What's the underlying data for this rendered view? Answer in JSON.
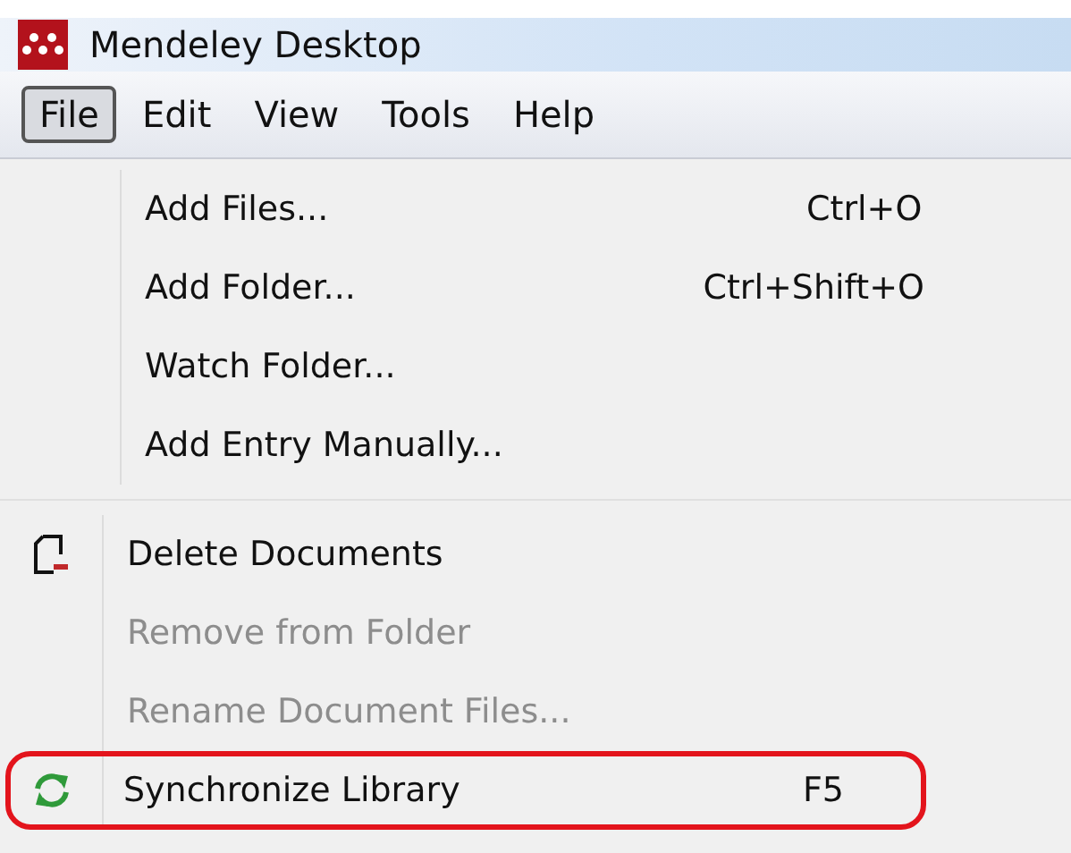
{
  "window": {
    "title": "Mendeley Desktop"
  },
  "menubar": [
    {
      "label": "File",
      "selected": true
    },
    {
      "label": "Edit",
      "selected": false
    },
    {
      "label": "View",
      "selected": false
    },
    {
      "label": "Tools",
      "selected": false
    },
    {
      "label": "Help",
      "selected": false
    }
  ],
  "menu_groups": [
    {
      "items": [
        {
          "label": "Add Files...",
          "shortcut": "Ctrl+O",
          "disabled": false,
          "highlighted": false,
          "kind": "plain"
        },
        {
          "label": "Add Folder...",
          "shortcut": "Ctrl+Shift+O",
          "disabled": false,
          "highlighted": false,
          "kind": "plain"
        },
        {
          "label": "Watch Folder...",
          "disabled": false,
          "highlighted": false,
          "kind": "plain"
        },
        {
          "label": "Add Entry Manually...",
          "disabled": false,
          "highlighted": false,
          "kind": "plain"
        }
      ]
    },
    {
      "items": [
        {
          "label": "Delete Documents",
          "disabled": false,
          "highlighted": false,
          "kind": "delete"
        },
        {
          "label": "Remove from Folder",
          "disabled": true,
          "highlighted": false,
          "kind": "plain"
        },
        {
          "label": "Rename Document Files...",
          "disabled": true,
          "highlighted": false,
          "kind": "plain"
        },
        {
          "label": "Synchronize Library",
          "shortcut": "F5",
          "disabled": false,
          "highlighted": true,
          "kind": "sync"
        }
      ]
    }
  ]
}
